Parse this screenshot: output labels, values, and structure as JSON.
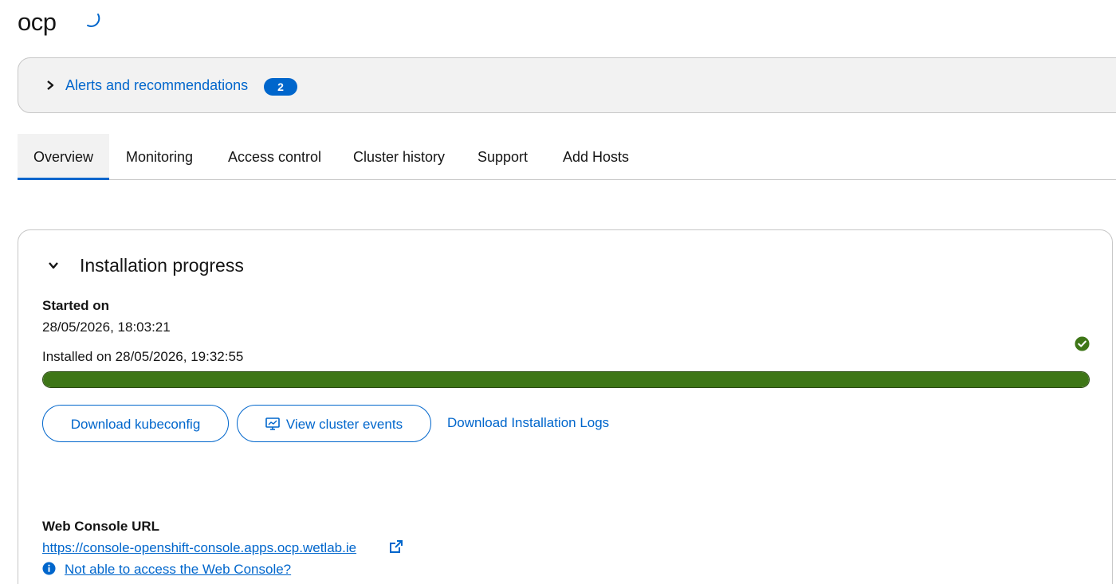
{
  "header": {
    "title": "ocp"
  },
  "alerts": {
    "label": "Alerts and recommendations",
    "count": "2"
  },
  "tabs": [
    {
      "label": "Overview",
      "active": true
    },
    {
      "label": "Monitoring",
      "active": false
    },
    {
      "label": "Access control",
      "active": false
    },
    {
      "label": "Cluster history",
      "active": false
    },
    {
      "label": "Support",
      "active": false
    },
    {
      "label": "Add Hosts",
      "active": false
    }
  ],
  "installation": {
    "title": "Installation progress",
    "started_label": "Started on",
    "started_value": "28/05/2026, 18:03:21",
    "installed_text": "Installed on 28/05/2026, 19:32:55",
    "status": "success",
    "progress_percent": 100,
    "buttons": {
      "download_kubeconfig": "Download kubeconfig",
      "view_events": "View cluster events",
      "download_logs": "Download Installation Logs"
    },
    "console": {
      "label": "Web Console URL",
      "url": "https://console-openshift-console.apps.ocp.wetlab.ie",
      "help_link": "Not able to access the Web Console?"
    }
  },
  "colors": {
    "link": "#0066cc",
    "success": "#3e7617",
    "border": "#c7c7c7",
    "surface": "#f2f2f2"
  },
  "icons": {
    "spinner": "loading-spinner-icon",
    "alerts_toggle": "chevron-right-icon",
    "card_toggle": "chevron-down-icon",
    "status": "check-circle-icon",
    "events": "monitor-icon",
    "external": "external-link-icon",
    "info": "info-circle-icon"
  }
}
